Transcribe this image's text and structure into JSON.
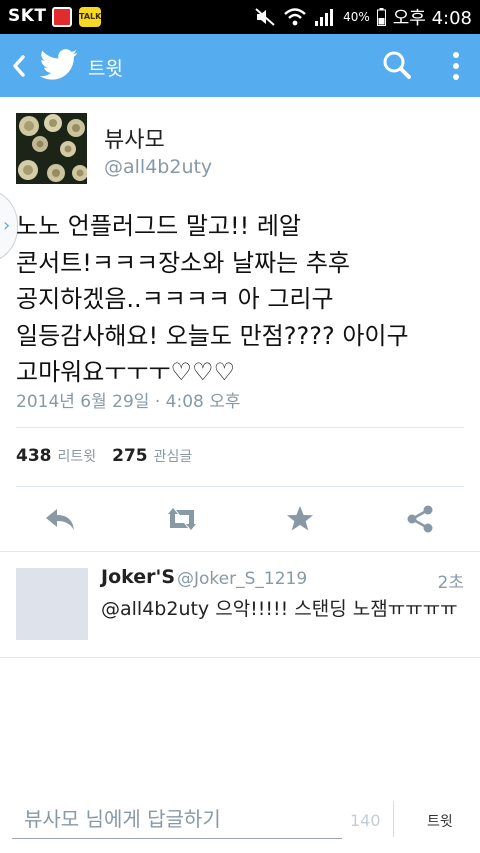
{
  "status_bar": {
    "carrier": "SKT",
    "kakao_label": "TALK",
    "battery": "40%",
    "time": "오후 4:08"
  },
  "app_bar": {
    "title": "트윗",
    "accent_color": "#55acee"
  },
  "tweet": {
    "author_name": "뷰사모",
    "author_handle": "@all4b2uty",
    "text_lines": [
      "노노 언플러그드 말고!! 레알",
      "콘서트!ㅋㅋㅋ장소와 날짜는 추후",
      "공지하겠음..ㅋㅋㅋㅋ 아 그리구",
      "일등감사해요! 오늘도 만점???? 아이구",
      "고마워요ㅜㅜㅜ♡♡♡"
    ],
    "timestamp": "2014년 6월 29일 · 4:08 오후",
    "retweets_count": "438",
    "retweets_label": "리트윗",
    "favorites_count": "275",
    "favorites_label": "관심글"
  },
  "actions": {
    "icons": [
      "reply-icon",
      "retweet-icon",
      "favorite-icon",
      "share-icon"
    ]
  },
  "reply": {
    "name": "Joker'S",
    "handle": "@Joker_S_1219",
    "time": "2초",
    "text": "@all4b2uty 으악!!!!! 스탠딩 노잼ㅠㅠㅠㅠ"
  },
  "compose": {
    "placeholder": "뷰사모 님에게 답글하기",
    "char_count": "140",
    "send_label": "트윗"
  }
}
